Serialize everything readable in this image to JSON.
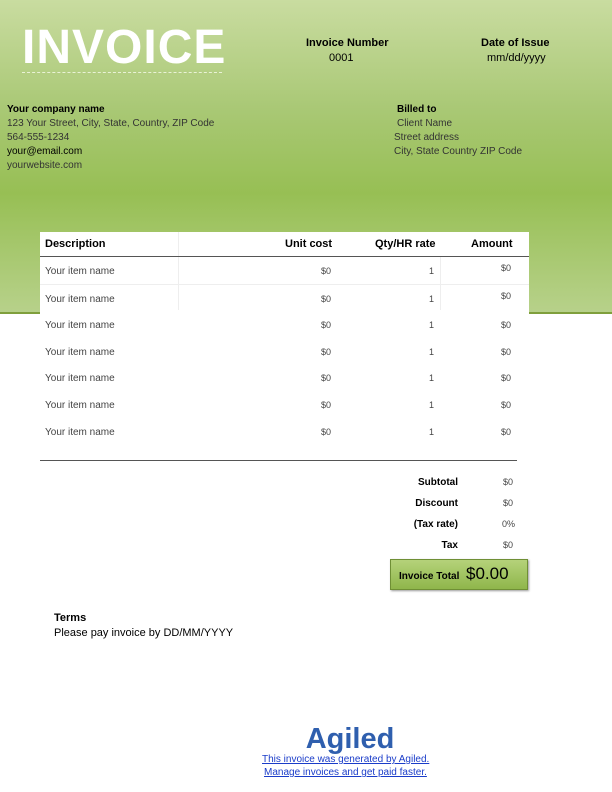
{
  "header": {
    "title": "INVOICE",
    "invoice_number_label": "Invoice Number",
    "invoice_number": "0001",
    "date_label": "Date of Issue",
    "date_value": "mm/dd/yyyy"
  },
  "company": {
    "name": "Your company name",
    "address": "123 Your Street, City, State, Country, ZIP Code",
    "phone": "564-555-1234",
    "email": "your@email.com",
    "website": "yourwebsite.com"
  },
  "billed_to": {
    "label": "Billed to",
    "client": "Client Name",
    "street": "Street address",
    "city": "City, State Country ZIP Code"
  },
  "table": {
    "headers": [
      "Description",
      "Unit cost",
      "Qty/HR rate",
      "Amount"
    ],
    "rows": [
      {
        "description": "Your item name",
        "unit_cost": "$0",
        "qty": "1",
        "amount": "$0"
      },
      {
        "description": "Your item name",
        "unit_cost": "$0",
        "qty": "1",
        "amount": "$0"
      },
      {
        "description": "Your item name",
        "unit_cost": "$0",
        "qty": "1",
        "amount": "$0"
      },
      {
        "description": "Your item name",
        "unit_cost": "$0",
        "qty": "1",
        "amount": "$0"
      },
      {
        "description": "Your item name",
        "unit_cost": "$0",
        "qty": "1",
        "amount": "$0"
      },
      {
        "description": "Your item name",
        "unit_cost": "$0",
        "qty": "1",
        "amount": "$0"
      },
      {
        "description": "Your item name",
        "unit_cost": "$0",
        "qty": "1",
        "amount": "$0"
      }
    ]
  },
  "totals": {
    "subtotal_label": "Subtotal",
    "subtotal": "$0",
    "discount_label": "Discount",
    "discount": "$0",
    "tax_rate_label": "(Tax rate)",
    "tax_rate": "0%",
    "tax_label": "Tax",
    "tax": "$0",
    "invoice_total_label": "Invoice Total",
    "invoice_total": "$0.00"
  },
  "terms": {
    "label": "Terms",
    "text": "Please pay invoice by DD/MM/YYYY"
  },
  "footer": {
    "logo_text": "Agiled",
    "line1": "This invoice was generated by Agiled.",
    "line2": "Manage invoices and get paid faster."
  },
  "colors": {
    "accent_green": "#97bf54",
    "link_blue": "#1a3cc9",
    "logo_blue": "#2f5fae"
  }
}
